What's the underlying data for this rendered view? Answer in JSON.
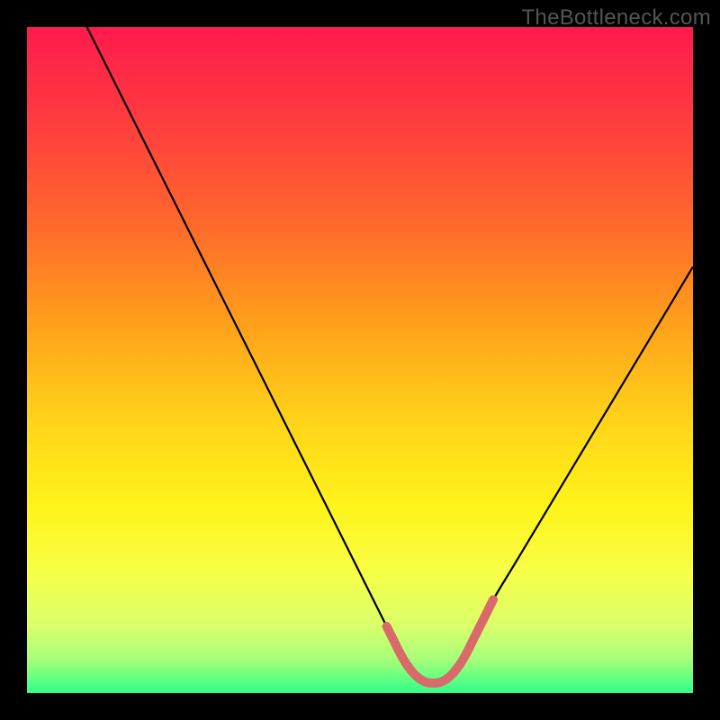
{
  "watermark": "TheBottleneck.com",
  "chart_data": {
    "type": "line",
    "title": "",
    "xlabel": "",
    "ylabel": "",
    "xlim": [
      0,
      100
    ],
    "ylim": [
      0,
      100
    ],
    "series": [
      {
        "name": "bottleneck-curve",
        "x": [
          9,
          12,
          15,
          18,
          21,
          24,
          27,
          30,
          33,
          36,
          39,
          42,
          45,
          48,
          51,
          54,
          56,
          58,
          60,
          62,
          64,
          66,
          68,
          70,
          73,
          76,
          79,
          82,
          85,
          88,
          91,
          94,
          97,
          100
        ],
        "values": [
          100,
          94,
          88,
          82,
          76,
          70,
          64,
          58,
          52,
          46,
          40,
          34,
          28,
          22,
          16,
          10,
          6,
          3,
          1.5,
          1.5,
          3,
          6,
          10,
          14,
          19,
          24,
          29,
          34,
          39,
          44,
          49,
          54,
          59,
          64
        ]
      }
    ],
    "highlight": {
      "name": "optimal-region",
      "x_start": 54,
      "x_end": 70,
      "x": [
        54,
        55,
        56,
        57,
        58,
        59,
        60,
        61,
        62,
        63,
        64,
        65,
        66,
        67,
        68,
        69,
        70
      ],
      "values": [
        10.0,
        8.0,
        6.0,
        4.3,
        3.0,
        2.1,
        1.6,
        1.5,
        1.6,
        2.1,
        3.0,
        4.3,
        6.0,
        8.0,
        10.0,
        12.0,
        14.0
      ]
    },
    "gradient_stops": [
      {
        "offset": 0.0,
        "color": "#ff1a4d"
      },
      {
        "offset": 0.15,
        "color": "#ff3e3e"
      },
      {
        "offset": 0.3,
        "color": "#ff6a2b"
      },
      {
        "offset": 0.45,
        "color": "#ffa21a"
      },
      {
        "offset": 0.6,
        "color": "#ffd61a"
      },
      {
        "offset": 0.72,
        "color": "#fff31a"
      },
      {
        "offset": 0.82,
        "color": "#f7ff47"
      },
      {
        "offset": 0.9,
        "color": "#d9ff6b"
      },
      {
        "offset": 0.95,
        "color": "#a6ff7a"
      },
      {
        "offset": 1.0,
        "color": "#2eff88"
      }
    ],
    "curve_color": "#000000",
    "highlight_color": "#d86a6a"
  }
}
